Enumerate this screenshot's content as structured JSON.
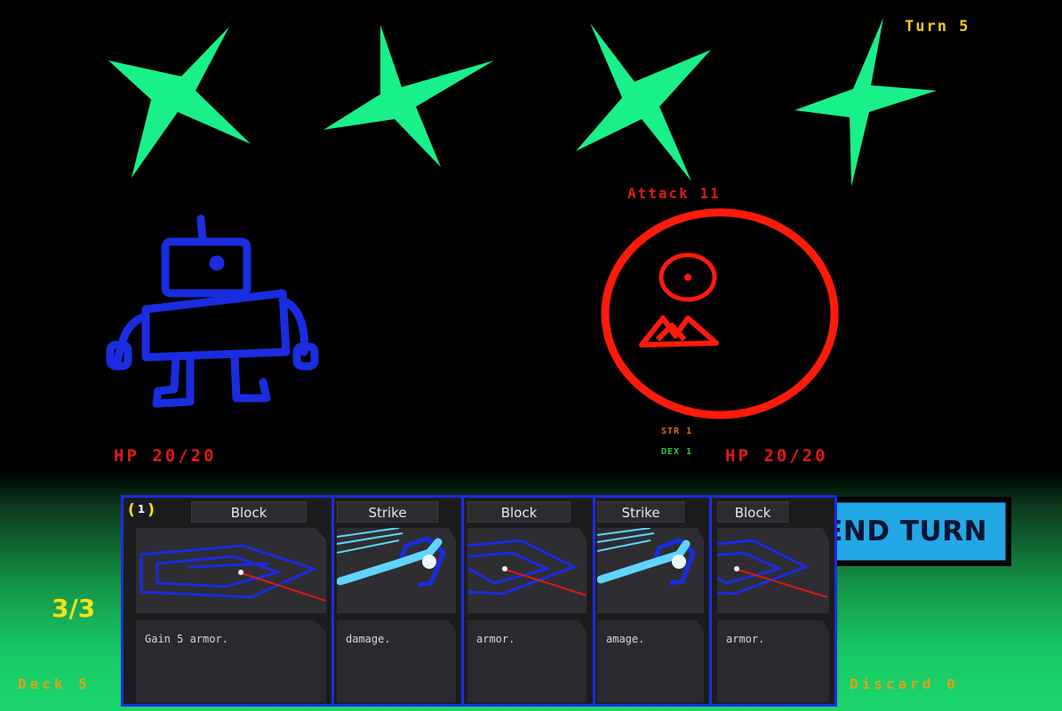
{
  "hud": {
    "turn_label": "Turn 5",
    "energy": "3/3",
    "deck_label": "Deck  5",
    "discard_label": "Discard  0",
    "end_turn_label": "END TURN"
  },
  "player": {
    "hp": "HP 20/20",
    "sprite": "robot-sprite",
    "color": "#1a2de0"
  },
  "enemy": {
    "intent": "Attack 11",
    "hp": "HP 20/20",
    "str": "STR 1",
    "dex": "DEX 1",
    "sprite": "cyclops-enemy-sprite",
    "color": "#ff1a0a"
  },
  "background": {
    "stars_color": "#19f08a",
    "ground_color": "#17c765"
  },
  "hand": [
    {
      "name": "Block",
      "cost": "1",
      "text": "Gain 5 armor.",
      "art": "shield-art"
    },
    {
      "name": "Strike",
      "text": "damage.",
      "art": "sword-art"
    },
    {
      "name": "Block",
      "text": "armor.",
      "art": "shield-art"
    },
    {
      "name": "Strike",
      "text": "amage.",
      "art": "sword-art"
    },
    {
      "name": "Block",
      "text": "armor.",
      "art": "shield-art"
    }
  ]
}
